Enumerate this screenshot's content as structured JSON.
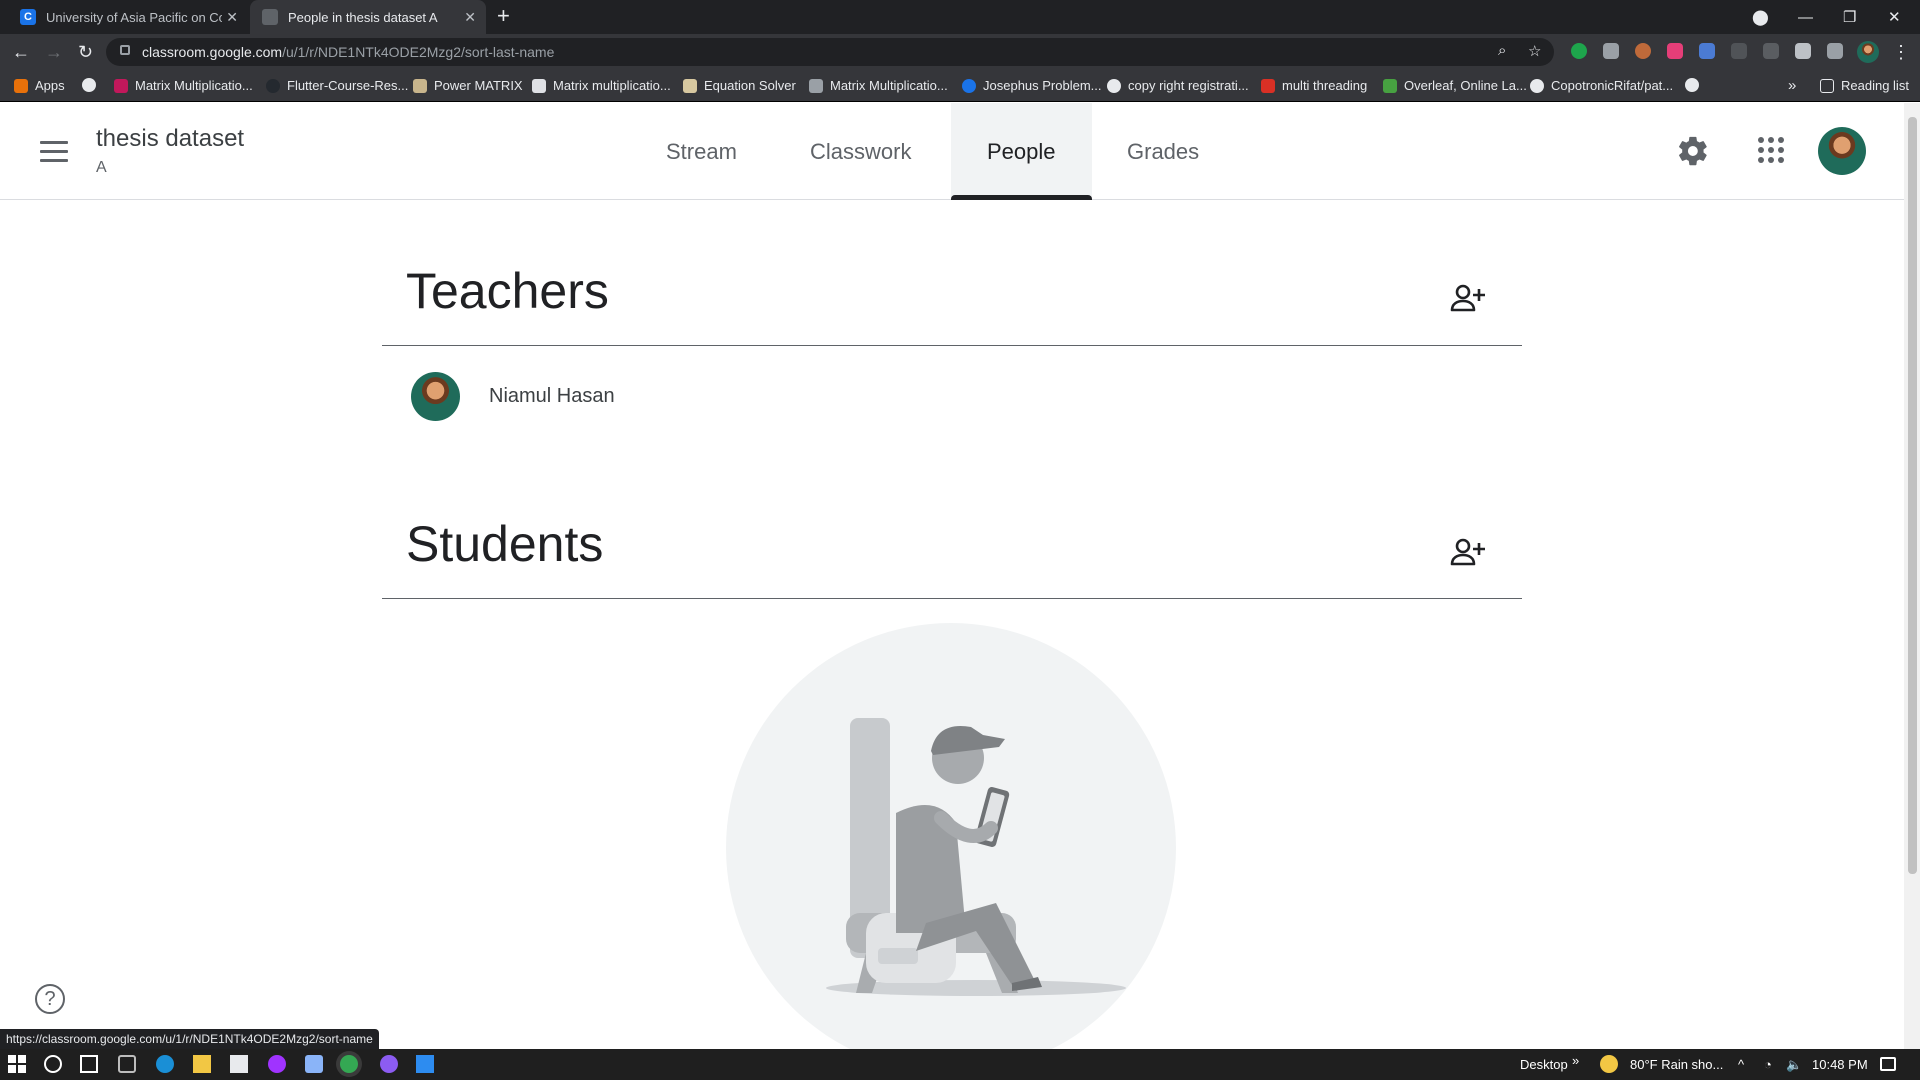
{
  "browser": {
    "tabs": [
      {
        "title": "University of Asia Pacific on Cour",
        "favicon": "C",
        "active": false
      },
      {
        "title": "People in thesis dataset A",
        "favicon": "person",
        "active": true
      }
    ],
    "url_domain": "classroom.google.com",
    "url_path": "/u/1/r/NDE1NTk4ODE2Mzg2/sort-last-name",
    "bookmarks": [
      "Apps",
      "Matrix Multiplicatio...",
      "Flutter-Course-Res...",
      "Power MATRIX",
      "Matrix multiplicatio...",
      "Equation Solver",
      "Matrix Multiplicatio...",
      "Josephus Problem...",
      "copy right registrati...",
      "multi threading",
      "Overleaf, Online La...",
      "CopotronicRifat/pat..."
    ],
    "bookmarks_overflow": "»",
    "reading_list": "Reading list",
    "status_url": "https://classroom.google.com/u/1/r/NDE1NTk4ODE2Mzg2/sort-name"
  },
  "class": {
    "title": "thesis dataset",
    "section": "A",
    "tabs": [
      "Stream",
      "Classwork",
      "People",
      "Grades"
    ],
    "active_tab": "People"
  },
  "teachers": {
    "heading": "Teachers",
    "people": [
      {
        "name": "Niamul Hasan"
      }
    ]
  },
  "students": {
    "heading": "Students",
    "people": []
  },
  "help_icon": "?",
  "taskbar": {
    "desktop_label": "Desktop",
    "overflow": "»",
    "weather": "80°F  Rain sho...",
    "time": "10:48 PM"
  },
  "colors": {
    "tab_strip": "#202124",
    "toolbar": "#35363a",
    "active_tab_indicator": "#202124",
    "text_primary": "#202124",
    "text_secondary": "#5f6368"
  }
}
